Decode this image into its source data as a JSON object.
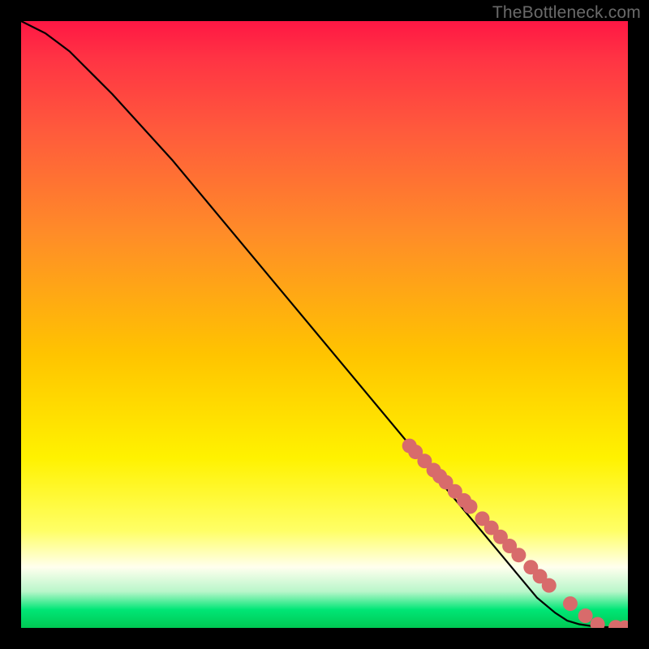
{
  "attribution": "TheBottleneck.com",
  "chart_data": {
    "type": "line",
    "title": "",
    "xlabel": "",
    "ylabel": "",
    "xlim": [
      0,
      100
    ],
    "ylim": [
      0,
      100
    ],
    "grid": false,
    "legend": false,
    "background": "rainbow-gradient-red-to-green",
    "series": [
      {
        "name": "curve",
        "style": "line",
        "color": "#000000",
        "x": [
          0,
          2,
          4,
          6,
          8,
          10,
          12,
          15,
          20,
          25,
          30,
          35,
          40,
          45,
          50,
          55,
          60,
          65,
          70,
          75,
          80,
          85,
          88,
          90,
          92,
          94,
          96,
          98,
          100
        ],
        "y": [
          100,
          99,
          98,
          96.5,
          95,
          93,
          91,
          88,
          82.5,
          77,
          71,
          65,
          59,
          53,
          47,
          41,
          35,
          29,
          23,
          17,
          11,
          5,
          2.5,
          1.2,
          0.6,
          0.3,
          0.15,
          0.08,
          0.05
        ]
      },
      {
        "name": "dots",
        "style": "scatter",
        "color": "#d86b6b",
        "x": [
          64,
          65,
          66.5,
          68,
          69,
          70,
          71.5,
          73,
          74,
          76,
          77.5,
          79,
          80.5,
          82,
          84,
          85.5,
          87,
          90.5,
          93,
          95,
          98,
          99.5
        ],
        "y": [
          30,
          29,
          27.5,
          26,
          25,
          24,
          22.5,
          21,
          20,
          18,
          16.5,
          15,
          13.5,
          12,
          10,
          8.5,
          7,
          4,
          2,
          0.6,
          0.1,
          0.05
        ]
      }
    ]
  }
}
